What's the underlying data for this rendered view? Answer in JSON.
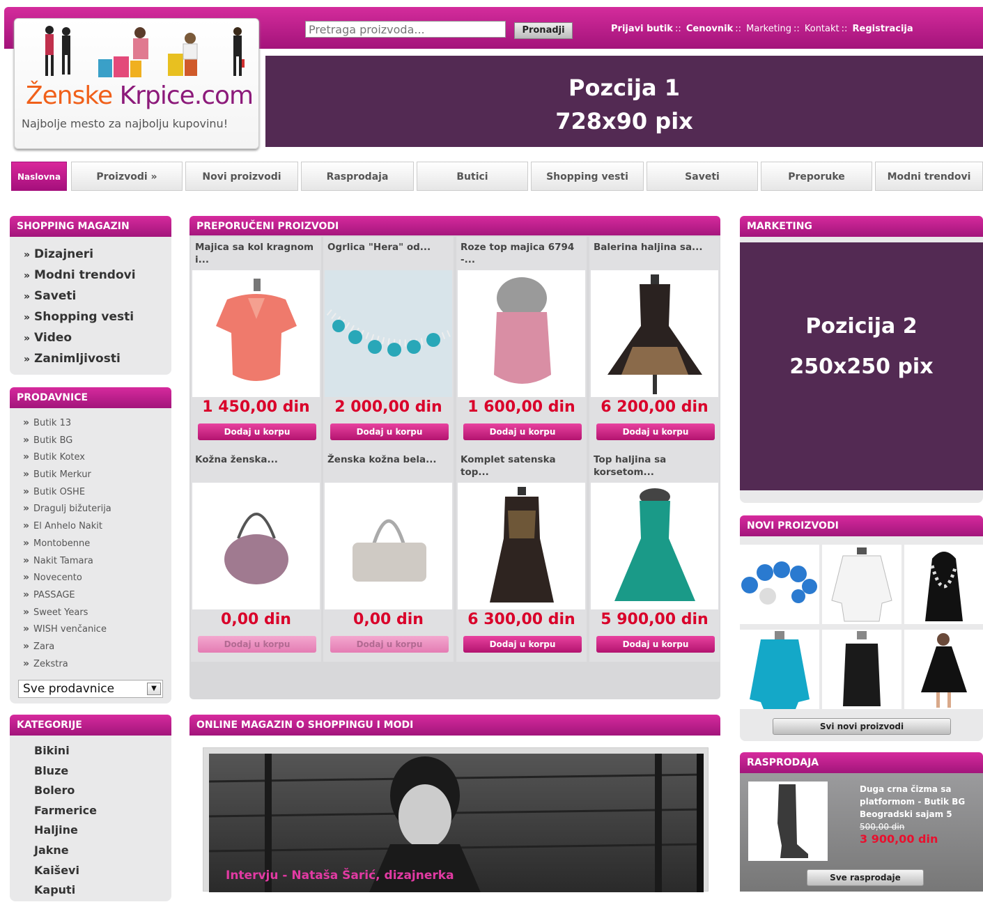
{
  "header": {
    "logo_text_a": "Ženske",
    "logo_text_b": "Krpice.com",
    "tagline": "Najbolje mesto za najbolju kupovinu!",
    "search_placeholder": "Pretraga proizvoda...",
    "search_button": "Pronadji",
    "links": [
      "Prijavi butik",
      "Cenovnik",
      "Marketing",
      "Kontakt",
      "Registracija"
    ],
    "link_separator": "::",
    "banner_line1": "Pozcija 1",
    "banner_line2": "728x90 pix"
  },
  "nav": [
    "Naslovna",
    "Proizvodi »",
    "Novi proizvodi",
    "Rasprodaja",
    "Butici",
    "Shopping vesti",
    "Saveti",
    "Preporuke",
    "Modni trendovi"
  ],
  "sidebar": {
    "magazin_title": "SHOPPING MAGAZIN",
    "magazin_items": [
      "Dizajneri",
      "Modni trendovi",
      "Saveti",
      "Shopping vesti",
      "Video",
      "Zanimljivosti"
    ],
    "prodavnice_title": "PRODAVNICE",
    "prodavnice_items": [
      "Butik 13",
      "Butik BG",
      "Butik Kotex",
      "Butik Merkur",
      "Butik OSHE",
      "Dragulj bižuterija",
      "El Anhelo Nakit",
      "Montobenne",
      "Nakit Tamara",
      "Novecento",
      "PASSAGE",
      "Sweet Years",
      "WISH venčanice",
      "Zara",
      "Zekstra"
    ],
    "select_value": "Sve prodavnice",
    "kategorije_title": "KATEGORIJE",
    "kategorije_items": [
      "Bikini",
      "Bluze",
      "Bolero",
      "Farmerice",
      "Haljine",
      "Jakne",
      "Kaiševi",
      "Kaputi"
    ]
  },
  "main": {
    "featured_title": "PREPORUČENI PROIZVODI",
    "cart_label": "Dodaj u korpu",
    "products": [
      {
        "title": "Majica sa kol kragnom i...",
        "price": "1 450,00 din",
        "icon": "top-icon"
      },
      {
        "title": "Ogrlica \"Hera\" od...",
        "price": "2 000,00 din",
        "icon": "necklace-icon"
      },
      {
        "title": "Roze top majica 6794 -...",
        "price": "1 600,00 din",
        "icon": "dress-icon"
      },
      {
        "title": "Balerina haljina sa...",
        "price": "6 200,00 din",
        "icon": "dress-icon"
      },
      {
        "title": "Kožna ženska...",
        "price": "0,00 din",
        "icon": "handbag-icon"
      },
      {
        "title": "Ženska kožna bela...",
        "price": "0,00 din",
        "icon": "handbag-icon"
      },
      {
        "title": "Komplet satenska top...",
        "price": "6 300,00 din",
        "icon": "dress-icon"
      },
      {
        "title": "Top haljina sa korsetom...",
        "price": "5 900,00 din",
        "icon": "dress-icon"
      }
    ],
    "magazine_title": "ONLINE MAGAZIN O SHOPPINGU I MODI",
    "magazine_caption": "Intervju - Nataša Šarić, dizajnerka"
  },
  "right": {
    "marketing_title": "MARKETING",
    "banner_line1": "Pozicija 2",
    "banner_line2": "250x250 pix",
    "new_title": "NOVI PROIZVODI",
    "new_button": "Svi novi proizvodi",
    "sale_title": "RASPRODAJA",
    "sale_desc": "Duga crna čizma sa platformom - Butik BG Beogradski sajam 5",
    "sale_old_price": "500,00 din",
    "sale_new_price": "3 900,00 din",
    "sale_button": "Sve rasprodaje"
  },
  "colors": {
    "accent": "#c21f8e",
    "banner": "#532a53",
    "price": "#d9002a"
  }
}
